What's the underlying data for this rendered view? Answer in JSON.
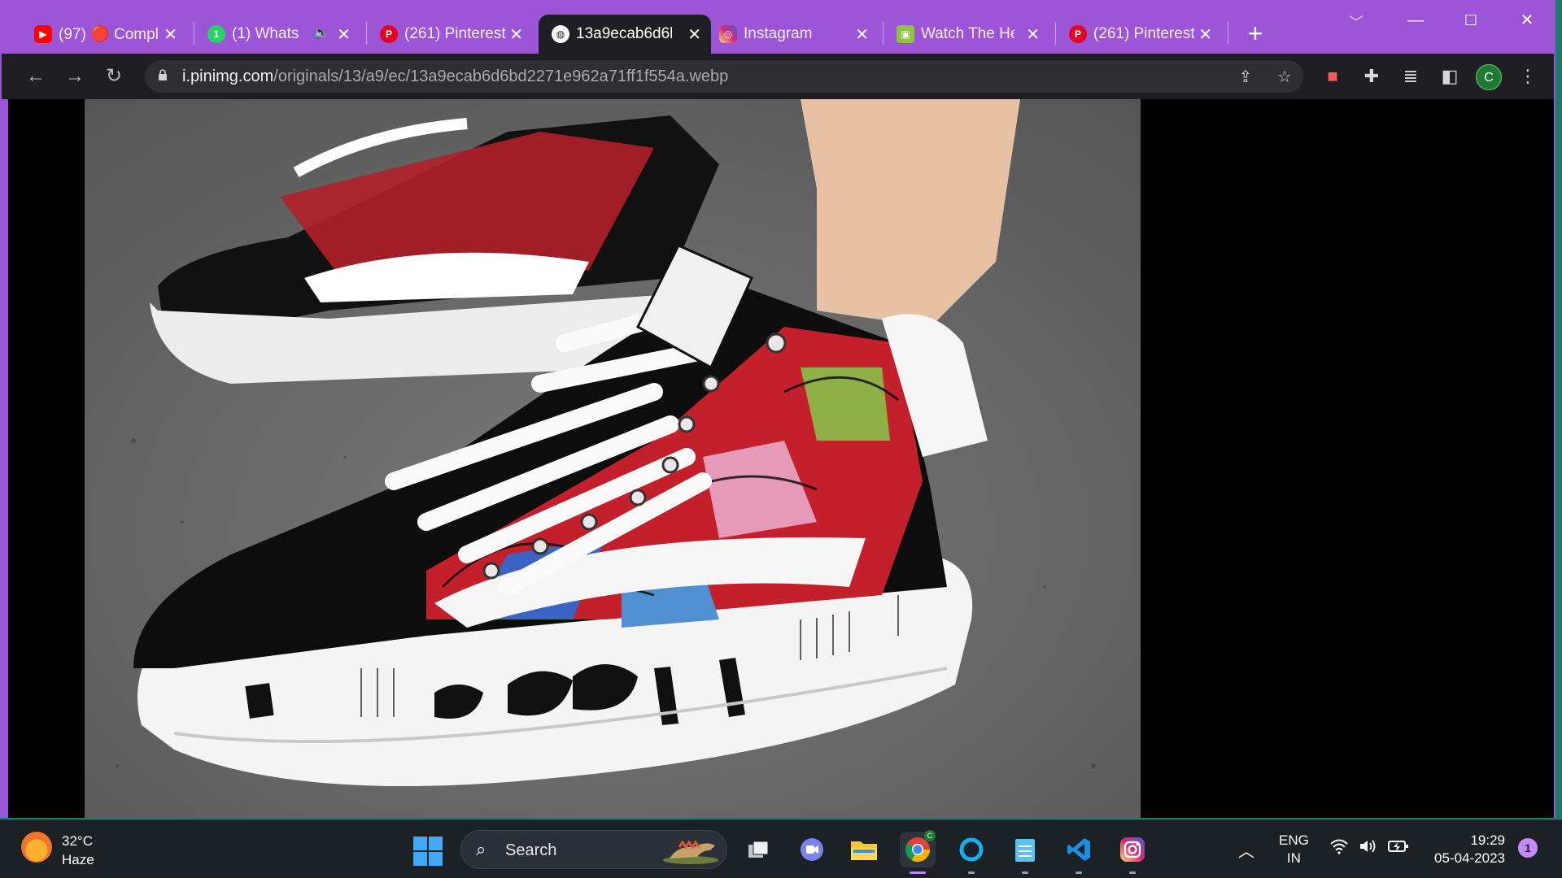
{
  "browser": {
    "tabs": [
      {
        "title": "(97) 🔴 Compl",
        "favicon": "youtube-icon",
        "color": "#ff0000",
        "active": false
      },
      {
        "title": "(1) Whats/",
        "favicon": "whatsapp-icon",
        "color": "#25d366",
        "active": false,
        "muted": true
      },
      {
        "title": "(261) Pinterest",
        "favicon": "pinterest-icon",
        "color": "#e60023",
        "active": false
      },
      {
        "title": "13a9ecab6d6b",
        "favicon": "globe-icon",
        "color": "#ffffff",
        "active": true
      },
      {
        "title": "Instagram",
        "favicon": "instagram-icon",
        "color": "#d62976",
        "active": false
      },
      {
        "title": "Watch The He",
        "favicon": "movie-site-icon",
        "color": "#e0c23a",
        "active": false
      },
      {
        "title": "(261) Pinterest",
        "favicon": "pinterest-icon",
        "color": "#e60023",
        "active": false
      }
    ],
    "address": {
      "host": "i.pinimg.com",
      "path": "/originals/13/a9/ec/13a9ecab6d6bd2271e962a71ff1f554a.webp"
    },
    "profile_initial": "C",
    "accent_color": "#9b55d6"
  },
  "taskbar": {
    "weather": {
      "temp": "32°C",
      "condition": "Haze"
    },
    "search_label": "Search",
    "language": {
      "line1": "ENG",
      "line2": "IN"
    },
    "clock": {
      "time": "19:29",
      "date": "05-04-2023"
    },
    "notification_count": "1"
  }
}
